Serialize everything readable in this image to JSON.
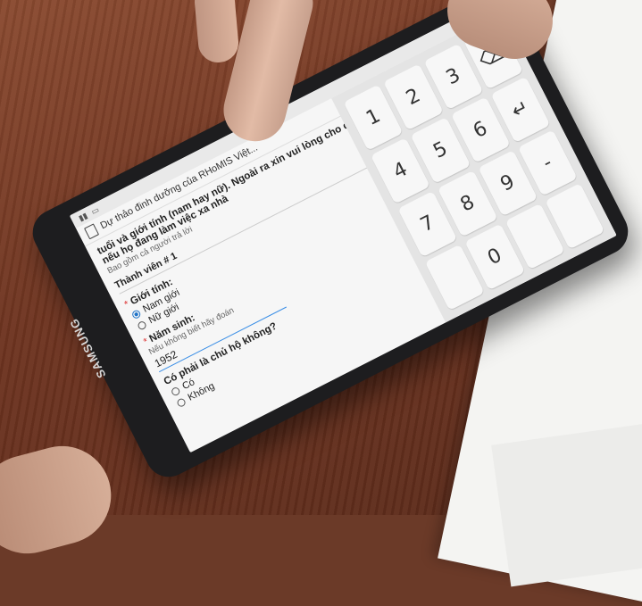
{
  "device": {
    "brand": "SAMSUNG"
  },
  "app": {
    "title": "Dự thảo đinh dưỡng của RHoMIS Việt...",
    "status_icons": [
      "battery-icon",
      "signal-icon",
      "menu-dots-icon"
    ]
  },
  "form": {
    "intro_line1": "tuổi và giới tính (nam hay nữ). Ngoài ra xin vui lòng cho cập",
    "intro_line2": "nếu họ đang làm việc xa nhà",
    "intro_hint": "Bao gồm cả người trả lời",
    "member_heading": "Thành viên # 1",
    "gender": {
      "label": "Giới tính:",
      "options": [
        "Nam giới",
        "Nữ giới"
      ],
      "selected": "Nam giới"
    },
    "birth_year": {
      "label": "Năm sinh:",
      "hint": "Nếu không biết hãy đoán",
      "value": "1952"
    },
    "household_head": {
      "label": "Có phải là chủ hộ không?",
      "options": [
        "Có",
        "Không"
      ]
    }
  },
  "keypad": {
    "keys": [
      "1",
      "2",
      "3",
      "⌫",
      "4",
      "5",
      "6",
      "↵",
      "7",
      "8",
      "9",
      "-",
      "",
      "0",
      "",
      ""
    ]
  }
}
